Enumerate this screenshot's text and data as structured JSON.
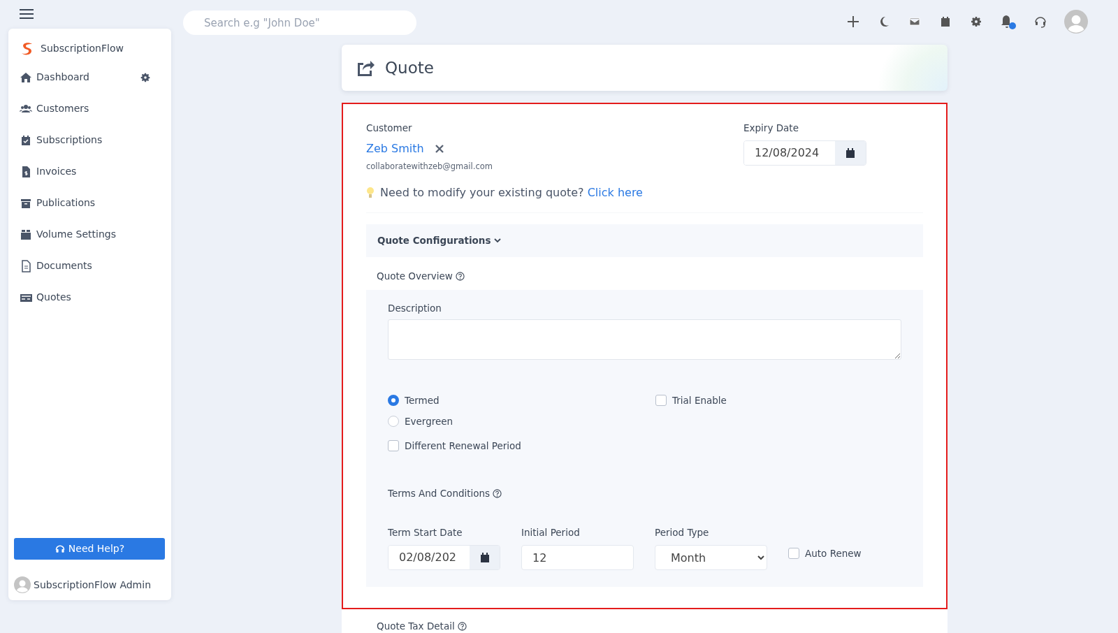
{
  "topbar": {
    "search": {
      "placeholder": "Search e.g \"John Doe\""
    },
    "has_notification": true
  },
  "sidebar": {
    "brand": "SubscriptionFlow",
    "items": [
      {
        "label": "Dashboard",
        "has_settings": true
      },
      {
        "label": "Customers",
        "has_settings": false
      },
      {
        "label": "Subscriptions",
        "has_settings": false
      },
      {
        "label": "Invoices",
        "has_settings": false
      },
      {
        "label": "Publications",
        "has_settings": false
      },
      {
        "label": "Volume Settings",
        "has_settings": false
      },
      {
        "label": "Documents",
        "has_settings": false
      },
      {
        "label": "Quotes",
        "has_settings": false
      }
    ],
    "help_button": "Need Help?",
    "user": "SubscriptionFlow Admin"
  },
  "page": {
    "title": "Quote"
  },
  "form": {
    "customer_label": "Customer",
    "customer_name": "Zeb Smith",
    "customer_email": "collaboratewithzeb@gmail.com",
    "expiry_label": "Expiry Date",
    "expiry_value": "12/08/2024",
    "hint": "Need to modify your existing quote?",
    "hint_link": "Click here",
    "config_header": "Quote Configurations",
    "overview_label": "Quote Overview",
    "description_label": "Description",
    "radios": [
      {
        "label": "Termed",
        "selected": true
      },
      {
        "label": "Evergreen",
        "selected": false
      }
    ],
    "trial": {
      "label": "Trial Enable",
      "checked": false
    },
    "renewal": {
      "label": "Different Renewal Period",
      "checked": false
    },
    "terms_label": "Terms And Conditions",
    "term_start": {
      "label": "Term Start Date",
      "value": "02/08/202"
    },
    "initial_period": {
      "label": "Initial Period",
      "value": "12"
    },
    "period_type": {
      "label": "Period Type",
      "value": "Month"
    },
    "auto_renew": {
      "label": "Auto Renew",
      "checked": false
    }
  },
  "tax_label": "Quote Tax Detail"
}
